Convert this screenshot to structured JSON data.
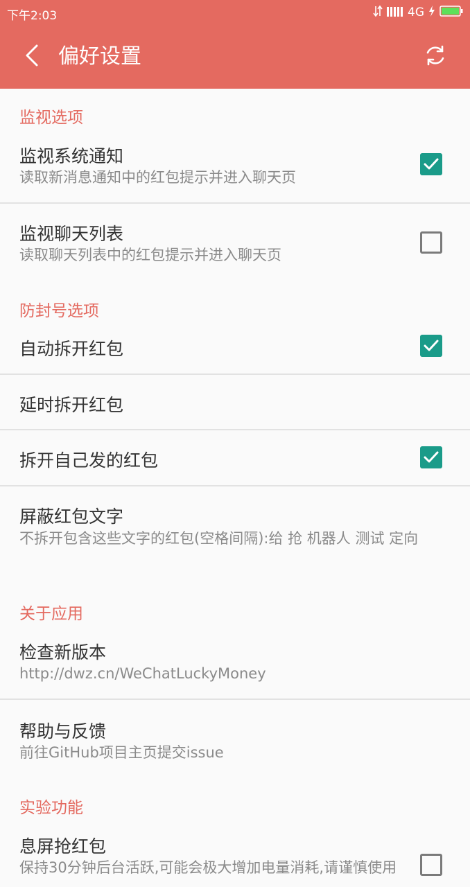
{
  "status_bar": {
    "time": "下午2:03",
    "network": "4G",
    "signal_icon": "signal-icon",
    "battery_icon": "battery-icon"
  },
  "app_bar": {
    "title": "偏好设置",
    "back_icon": "back-arrow-icon",
    "refresh_icon": "refresh-icon"
  },
  "sections": {
    "monitor": {
      "header": "监视选项",
      "items": [
        {
          "title": "监视系统通知",
          "summary": "读取新消息通知中的红包提示并进入聊天页",
          "checked": true
        },
        {
          "title": "监视聊天列表",
          "summary": "读取聊天列表中的红包提示并进入聊天页",
          "checked": false
        }
      ]
    },
    "anti_ban": {
      "header": "防封号选项",
      "items": [
        {
          "title": "自动拆开红包",
          "checked": true
        },
        {
          "title": "延时拆开红包"
        },
        {
          "title": "拆开自己发的红包",
          "checked": true
        },
        {
          "title": "屏蔽红包文字",
          "summary": "不拆开包含这些文字的红包(空格间隔):给 抢 机器人 测试 定向"
        }
      ]
    },
    "about": {
      "header": "关于应用",
      "items": [
        {
          "title": "检查新版本",
          "summary": "http://dwz.cn/WeChatLuckyMoney"
        },
        {
          "title": "帮助与反馈",
          "summary": "前往GitHub项目主页提交issue"
        }
      ]
    },
    "experimental": {
      "header": "实验功能",
      "items": [
        {
          "title": "息屏抢红包",
          "summary": "保持30分钟后台活跃,可能会极大增加电量消耗,请谨慎使用",
          "checked": false
        }
      ]
    }
  },
  "colors": {
    "accent": "#e46a60",
    "checkbox_on": "#1a9b89",
    "checkbox_off": "#7a7a7a",
    "text_primary": "#333333",
    "text_secondary": "#8a8a8a"
  }
}
